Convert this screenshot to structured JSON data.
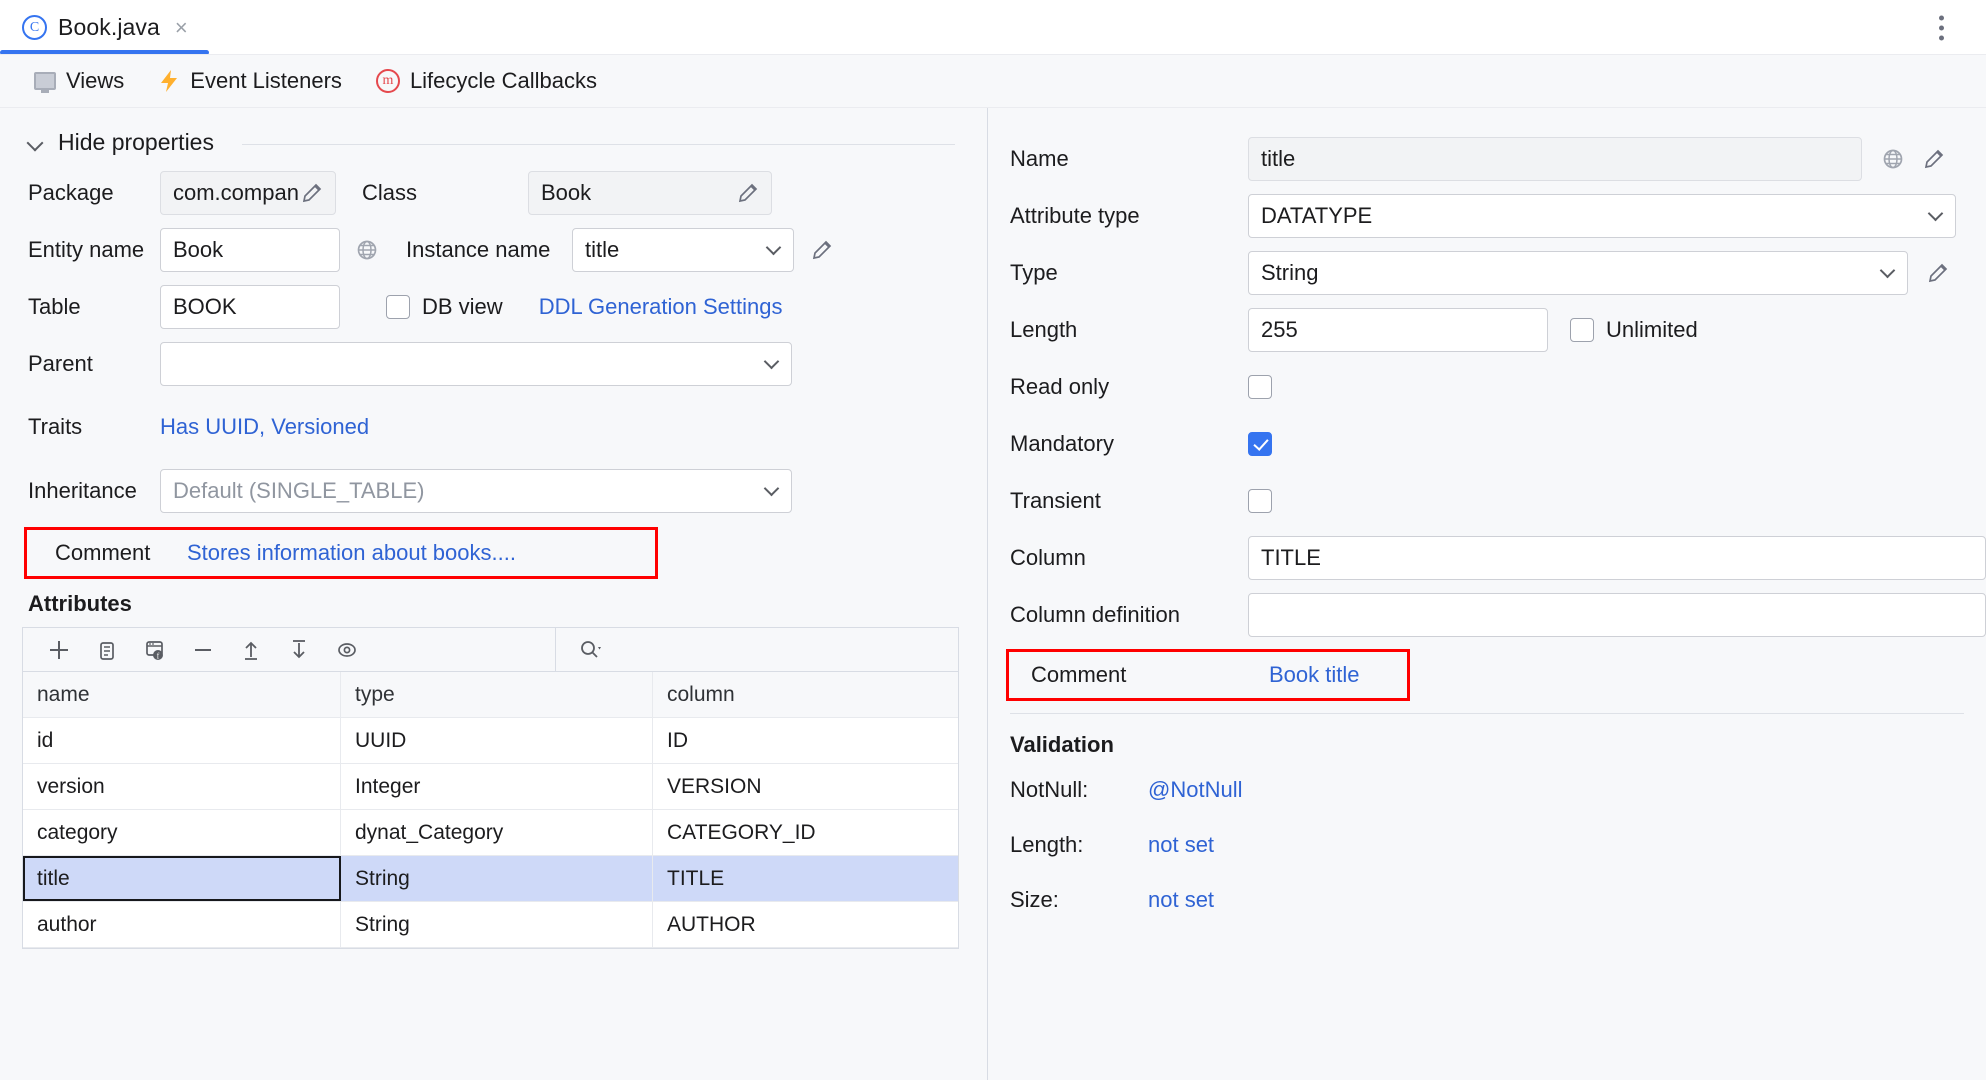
{
  "tab": {
    "icon": "java-class-icon",
    "title": "Book.java",
    "close": "×",
    "menu_icon": "more-vertical-icon"
  },
  "toolbar": {
    "items": [
      {
        "icon": "views-monitor-icon",
        "label": "Views"
      },
      {
        "icon": "event-listeners-bolt-icon",
        "label": "Event Listeners"
      },
      {
        "icon": "lifecycle-callbacks-icon",
        "label": "Lifecycle Callbacks"
      }
    ]
  },
  "left": {
    "collapse_label": "Hide properties",
    "package": {
      "label": "Package",
      "value": "com.compan",
      "edit_icon": "pencil-icon"
    },
    "class": {
      "label": "Class",
      "value": "Book",
      "edit_icon": "pencil-icon"
    },
    "entity_name": {
      "label": "Entity name",
      "value": "Book",
      "globe_icon": "globe-icon"
    },
    "instance_name": {
      "label": "Instance name",
      "value": "title",
      "edit_icon": "pencil-icon"
    },
    "table": {
      "label": "Table",
      "value": "BOOK"
    },
    "db_view": {
      "label": "DB view",
      "checked": false
    },
    "ddl_link": "DDL Generation Settings",
    "parent": {
      "label": "Parent",
      "value": ""
    },
    "traits": {
      "label": "Traits",
      "value": "Has UUID, Versioned"
    },
    "inheritance": {
      "label": "Inheritance",
      "placeholder": "Default (SINGLE_TABLE)"
    },
    "comment": {
      "label": "Comment",
      "value": "Stores information about books....",
      "highlighted": true
    },
    "attributes": {
      "title": "Attributes",
      "toolbar_icons": [
        "add-icon",
        "copy-icon",
        "add-from-database-icon",
        "remove-icon",
        "move-up-icon",
        "move-down-icon",
        "preview-eye-icon"
      ],
      "search_icon": "search-icon",
      "columns": [
        "name",
        "type",
        "column"
      ],
      "rows": [
        {
          "name": "id",
          "type": "UUID",
          "column": "ID",
          "selected": false
        },
        {
          "name": "version",
          "type": "Integer",
          "column": "VERSION",
          "selected": false
        },
        {
          "name": "category",
          "type": "dynat_Category",
          "column": "CATEGORY_ID",
          "selected": false
        },
        {
          "name": "title",
          "type": "String",
          "column": "TITLE",
          "selected": true
        },
        {
          "name": "author",
          "type": "String",
          "column": "AUTHOR",
          "selected": false
        }
      ]
    }
  },
  "right": {
    "name": {
      "label": "Name",
      "value": "title",
      "globe_icon": "globe-icon",
      "edit_icon": "pencil-icon"
    },
    "attribute_type": {
      "label": "Attribute type",
      "value": "DATATYPE"
    },
    "type": {
      "label": "Type",
      "value": "String",
      "edit_icon": "pencil-icon"
    },
    "length": {
      "label": "Length",
      "value": "255"
    },
    "unlimited": {
      "label": "Unlimited",
      "checked": false
    },
    "read_only": {
      "label": "Read only",
      "checked": false
    },
    "mandatory": {
      "label": "Mandatory",
      "checked": true
    },
    "transient": {
      "label": "Transient",
      "checked": false
    },
    "column": {
      "label": "Column",
      "value": "TITLE"
    },
    "column_definition": {
      "label": "Column definition",
      "value": ""
    },
    "comment": {
      "label": "Comment",
      "value": "Book title",
      "highlighted": true
    },
    "validation": {
      "title": "Validation",
      "rows": [
        {
          "label": "NotNull:",
          "value": "@NotNull"
        },
        {
          "label": "Length:",
          "value": "not set"
        },
        {
          "label": "Size:",
          "value": "not set"
        }
      ]
    }
  },
  "colors": {
    "accent": "#3574F0",
    "link": "#2F63D4",
    "highlight": "#FF0000",
    "selection": "#CED9F8",
    "panel_bg": "#F7F8FA"
  }
}
